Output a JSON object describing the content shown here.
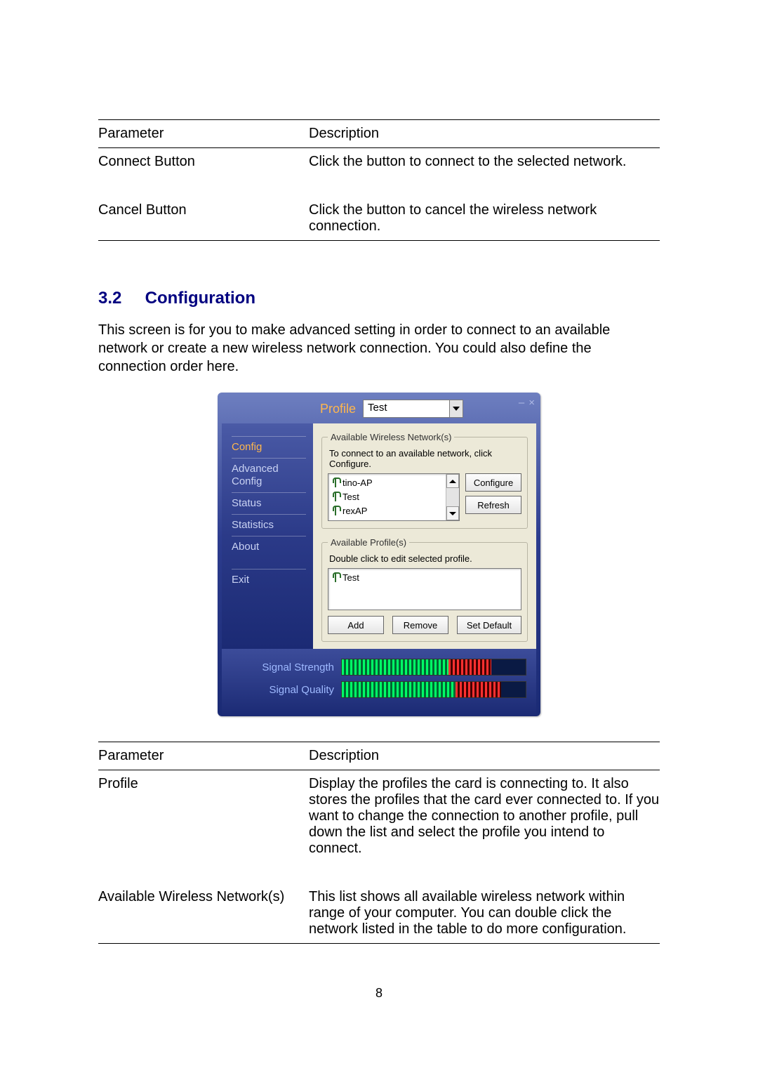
{
  "table1": {
    "head_param": "Parameter",
    "head_desc": "Description",
    "rows": [
      {
        "param": "Connect Button",
        "desc": "Click the button to connect to the selected network."
      },
      {
        "param": "Cancel Button",
        "desc": "Click the button to cancel the wireless network connection."
      }
    ]
  },
  "section": {
    "num": "3.2",
    "title": "Configuration",
    "intro": "This screen is for you to make advanced setting in order to connect to an available network or create a new wireless network connection. You could also define the connection order here."
  },
  "app": {
    "profile_label": "Profile",
    "profile_value": "Test",
    "window_min": "–",
    "window_close": "×",
    "sidebar": {
      "items": [
        {
          "label": "Config",
          "active": true
        },
        {
          "label": "Advanced Config"
        },
        {
          "label": "Status"
        },
        {
          "label": "Statistics"
        },
        {
          "label": "About"
        },
        {
          "label": "Exit"
        }
      ]
    },
    "networks": {
      "legend": "Available Wireless Network(s)",
      "hint": "To connect to an available network, click Configure.",
      "items": [
        "tino-AP",
        "Test",
        "rexAP"
      ],
      "configure": "Configure",
      "refresh": "Refresh"
    },
    "profiles": {
      "legend": "Available Profile(s)",
      "hint": "Double click to edit selected profile.",
      "items": [
        "Test"
      ],
      "add": "Add",
      "remove": "Remove",
      "setdef": "Set Default"
    },
    "signal": {
      "strength_label": "Signal Strength",
      "quality_label": "Signal Quality"
    }
  },
  "table2": {
    "head_param": "Parameter",
    "head_desc": "Description",
    "rows": [
      {
        "param": "Profile",
        "desc": "Display the profiles the card is connecting to. It also stores the profiles that the card ever connected to. If you want to change the connection to another profile, pull down the list and select the profile you intend to connect."
      },
      {
        "param": "Available Wireless Network(s)",
        "desc": "This list shows all available wireless network within range of your computer. You can double click the network listed in the table to do more configuration."
      }
    ]
  },
  "page_number": "8"
}
